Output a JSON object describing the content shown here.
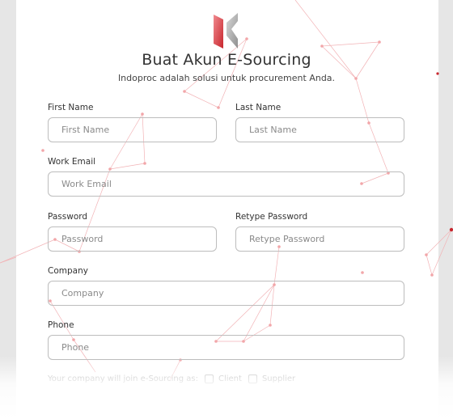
{
  "header": {
    "title": "Buat Akun E-Sourcing",
    "subtitle": "Indoproc adalah solusi untuk procurement Anda."
  },
  "form": {
    "first_name": {
      "label": "First Name",
      "placeholder": "First Name",
      "value": ""
    },
    "last_name": {
      "label": "Last Name",
      "placeholder": "Last Name",
      "value": ""
    },
    "work_email": {
      "label": "Work Email",
      "placeholder": "Work Email",
      "value": ""
    },
    "password": {
      "label": "Password",
      "placeholder": "Password",
      "value": ""
    },
    "retype_password": {
      "label": "Retype Password",
      "placeholder": "Retype Password",
      "value": ""
    },
    "company": {
      "label": "Company",
      "placeholder": "Company",
      "value": ""
    },
    "phone": {
      "label": "Phone",
      "placeholder": "Phone",
      "value": ""
    },
    "role": {
      "prompt": "Your company will join e-Sourcing as:",
      "options": [
        "Client",
        "Supplier"
      ]
    }
  },
  "colors": {
    "accent": "#d9343b",
    "network": "#f2a6a9",
    "border": "#bdbdbd"
  },
  "icons": {
    "logo": "indoproc-logo"
  }
}
